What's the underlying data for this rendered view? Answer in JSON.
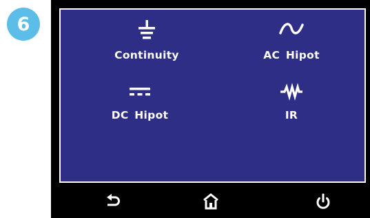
{
  "step": {
    "number": "6",
    "color": "#5bbde8"
  },
  "screen": {
    "background": "#2f2e86"
  },
  "tests": [
    {
      "label": "Continuity",
      "icon": "ground-icon"
    },
    {
      "label": "AC Hipot",
      "icon": "ac-sine-icon"
    },
    {
      "label": "DC Hipot",
      "icon": "dc-icon"
    },
    {
      "label": "IR",
      "icon": "resistor-icon"
    }
  ],
  "softkeys": [
    {
      "icon": "back-arrow-icon"
    },
    {
      "icon": "home-icon"
    },
    {
      "icon": "power-icon"
    }
  ]
}
